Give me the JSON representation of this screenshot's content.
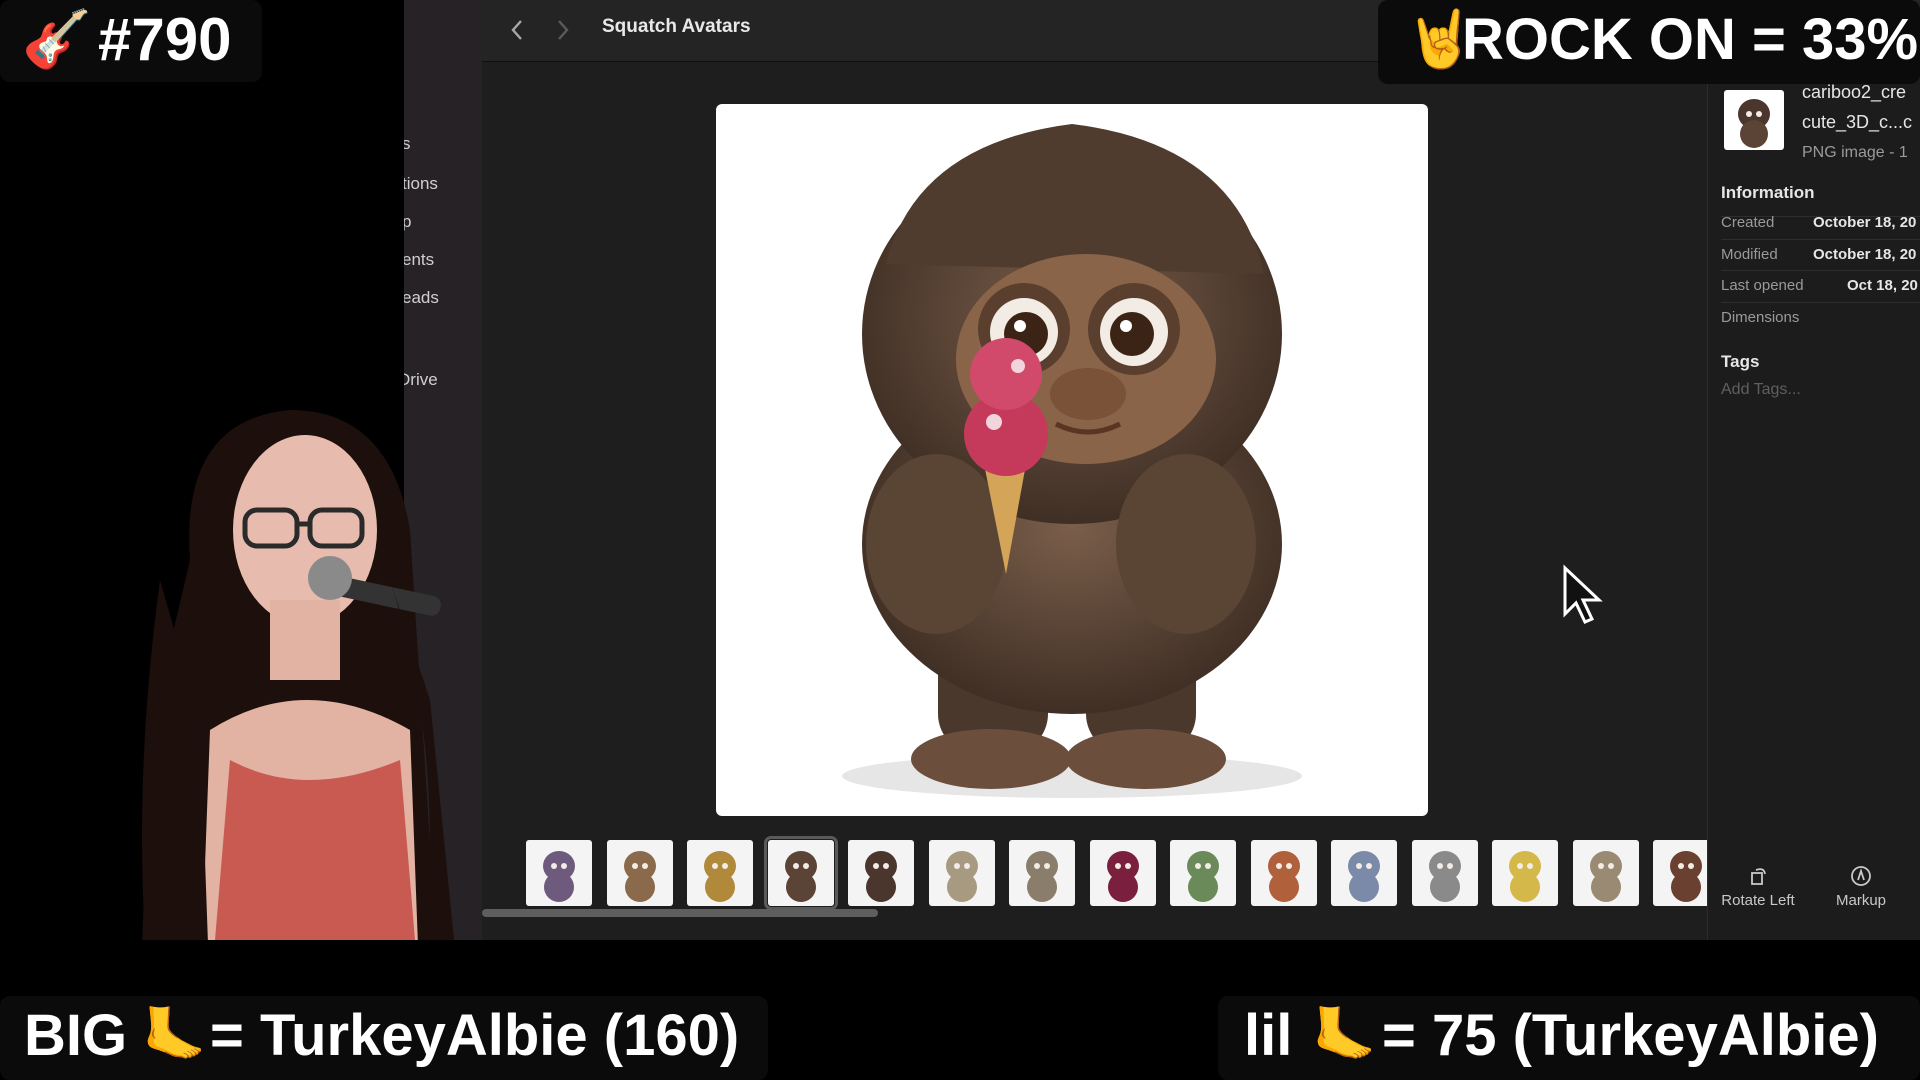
{
  "overlay": {
    "episode": "#790",
    "guitar_icon": "🎸",
    "rock_icon": "🤘",
    "rock_on_text": "ROCK ON = 33%",
    "big_label": "BIG",
    "foot_icon": "🦶",
    "big_value": "= TurkeyAlbie (160)",
    "lil_label": "lil",
    "lil_value": "=  75 (TurkeyAlbie)"
  },
  "sidebar": {
    "items": [
      {
        "label": "s"
      },
      {
        "label": "tions"
      },
      {
        "label": "p"
      },
      {
        "label": "ents"
      },
      {
        "label": "eads"
      },
      {
        "label": "Drive"
      }
    ]
  },
  "toolbar": {
    "title": "Squatch Avatars",
    "back_icon": "chevron-left-icon",
    "forward_icon": "chevron-right-icon",
    "views": [
      "icon-view",
      "list-view",
      "column-view",
      "gallery-view"
    ],
    "active_view": "gallery-view",
    "group_icon": "group-by-icon"
  },
  "inspector": {
    "filename_line1": "cariboo2_cre",
    "filename_line2": "cute_3D_c...c",
    "kind": "PNG image - 1",
    "info_heading": "Information",
    "rows": [
      {
        "label": "Created",
        "value": "October 18, 20"
      },
      {
        "label": "Modified",
        "value": "October 18, 20"
      },
      {
        "label": "Last opened",
        "value": "Oct 18, 20"
      },
      {
        "label": "Dimensions",
        "value": ""
      }
    ],
    "tags_heading": "Tags",
    "tags_placeholder": "Add Tags..."
  },
  "actions": {
    "rotate_left": "Rotate Left",
    "markup": "Markup"
  },
  "colors": {
    "thumb_colors": [
      "#6e5a7c",
      "#8a6a4a",
      "#b08a3a",
      "#5b4436",
      "#4a362c",
      "#a89a80",
      "#8b7d6b",
      "#7a1f3d",
      "#6b8a5a",
      "#b0603a",
      "#7a8aa8",
      "#8a8a8a",
      "#d4b84a",
      "#9a8a74",
      "#6a4030"
    ]
  }
}
